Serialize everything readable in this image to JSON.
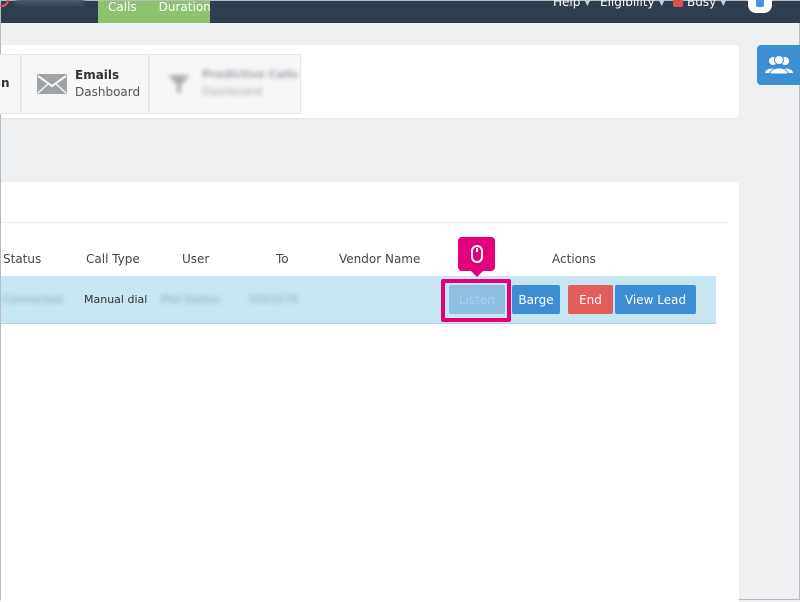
{
  "topbar": {
    "kpi_tabs": [
      "Calls",
      "Duration"
    ],
    "right_items": [
      {
        "label": "Help"
      },
      {
        "label": "Eligibility"
      },
      {
        "label": "Busy",
        "status_color": "#d9534f"
      }
    ],
    "colors": {
      "bar": "#2f3e4e",
      "kpi": "#8dc26f"
    }
  },
  "dashboard": {
    "partial_item": {
      "title_fragment": "n"
    },
    "emails": {
      "title": "Emails",
      "subtitle": "Dashboard",
      "icon": "envelope-icon"
    },
    "predictive": {
      "title": "Predictive Calls",
      "subtitle": "Dashboard",
      "icon": "funnel-icon"
    }
  },
  "side_button": {
    "icon": "users-icon",
    "color": "#3d8fd1"
  },
  "calls_table": {
    "headers": {
      "status": "Status",
      "call_type": "Call Type",
      "user": "User",
      "to": "To",
      "vendor_name": "Vendor Name",
      "actions": "Actions"
    },
    "rows": [
      {
        "status": "Connected",
        "call_type": "Manual dial",
        "user": "Phil Dalton",
        "to": "5553270",
        "vendor_name": "",
        "actions": {
          "listen": "Listen",
          "barge": "Barge",
          "end": "End",
          "view_lead": "View Lead"
        }
      }
    ],
    "row_color": "#c7e6f1"
  },
  "overlay": {
    "icon": "mouse-icon",
    "color": "#e4007c"
  }
}
